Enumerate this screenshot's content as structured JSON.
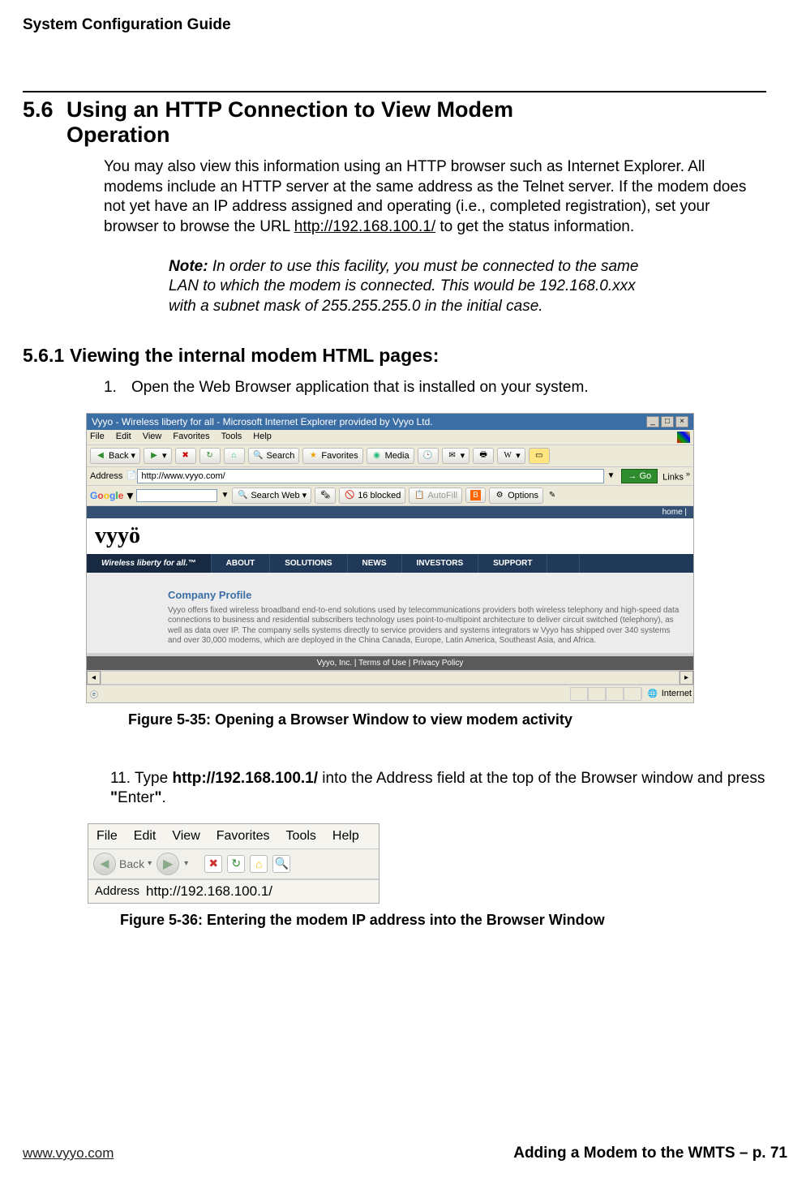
{
  "doc": {
    "title": "System Configuration Guide"
  },
  "section": {
    "num": "5.6",
    "title": "Using an HTTP Connection to View Modem Operation",
    "para": "You may also view this information using an HTTP browser such as Internet Explorer.  All modems include an HTTP server at the same address as the Telnet server.  If the modem does not yet have an IP address assigned and operating (i.e., completed registration), set your browser to browse the URL ",
    "url": "http://192.168.100.1/",
    "para_end": " to get the status information."
  },
  "note": {
    "label": "Note:",
    "text": " In order to use this facility, you must be connected to the same LAN to which the modem is connected.  This would be 192.168.0.xxx with a subnet mask of 255.255.255.0 in the initial case."
  },
  "subsec": {
    "num": "5.6.1",
    "title": "Viewing the internal modem HTML pages:"
  },
  "step1": {
    "no": "1.",
    "text": "Open the Web Browser application that is installed on your system."
  },
  "bw": {
    "title": "Vyyo - Wireless liberty for all - Microsoft Internet Explorer provided by Vyyo Ltd.",
    "menus": [
      "File",
      "Edit",
      "View",
      "Favorites",
      "Tools",
      "Help"
    ],
    "toolbar": {
      "back": "Back",
      "search": "Search",
      "favorites": "Favorites",
      "media": "Media"
    },
    "address_label": "Address",
    "address": "http://www.vyyo.com/",
    "go": "Go",
    "links": "Links",
    "google": {
      "name": "Google",
      "searchweb": "Search Web",
      "blocked": "16 blocked",
      "autofill": "AutoFill",
      "options": "Options"
    },
    "site": {
      "home": "home |",
      "logo": "vyyö",
      "tagline": "Wireless liberty for all.™",
      "nav": [
        "ABOUT",
        "SOLUTIONS",
        "NEWS",
        "INVESTORS",
        "SUPPORT"
      ],
      "profile_title": "Company Profile",
      "profile_text": "Vyyo offers fixed wireless broadband end-to-end solutions used by telecommunications providers both wireless telephony and high-speed data connections to business and residential subscribers technology uses point-to-multipoint architecture to deliver circuit switched (telephony), as well as data over IP. The company sells systems directly to service providers and systems integrators w Vyyo has shipped over 340 systems and over 30,000 modems, which are deployed in the China Canada, Europe, Latin America, Southeast Asia, and Africa.",
      "footer": "Vyyo, Inc. | Terms of Use | Privacy Policy"
    },
    "status_internet": "Internet"
  },
  "fig1": {
    "caption": "Figure 5-35: Opening a Browser Window to view modem activity"
  },
  "step11": {
    "no": "11.",
    "pre": "Type ",
    "bold": "http://192.168.100.1/",
    "post": " into the Address field at the top of the Browser window and press ",
    "q1": "\"",
    "enter": "Enter",
    "q2": "\"",
    "period": "."
  },
  "bw2": {
    "menus": [
      "File",
      "Edit",
      "View",
      "Favorites",
      "Tools",
      "Help"
    ],
    "back": "Back",
    "address_label": "Address",
    "address": "http://192.168.100.1/"
  },
  "fig2": {
    "caption": "Figure 5-36:  Entering the modem IP address into the Browser Window"
  },
  "footer": {
    "left": "www.vyyo.com",
    "right": "Adding a Modem to the WMTS – p. 71"
  }
}
